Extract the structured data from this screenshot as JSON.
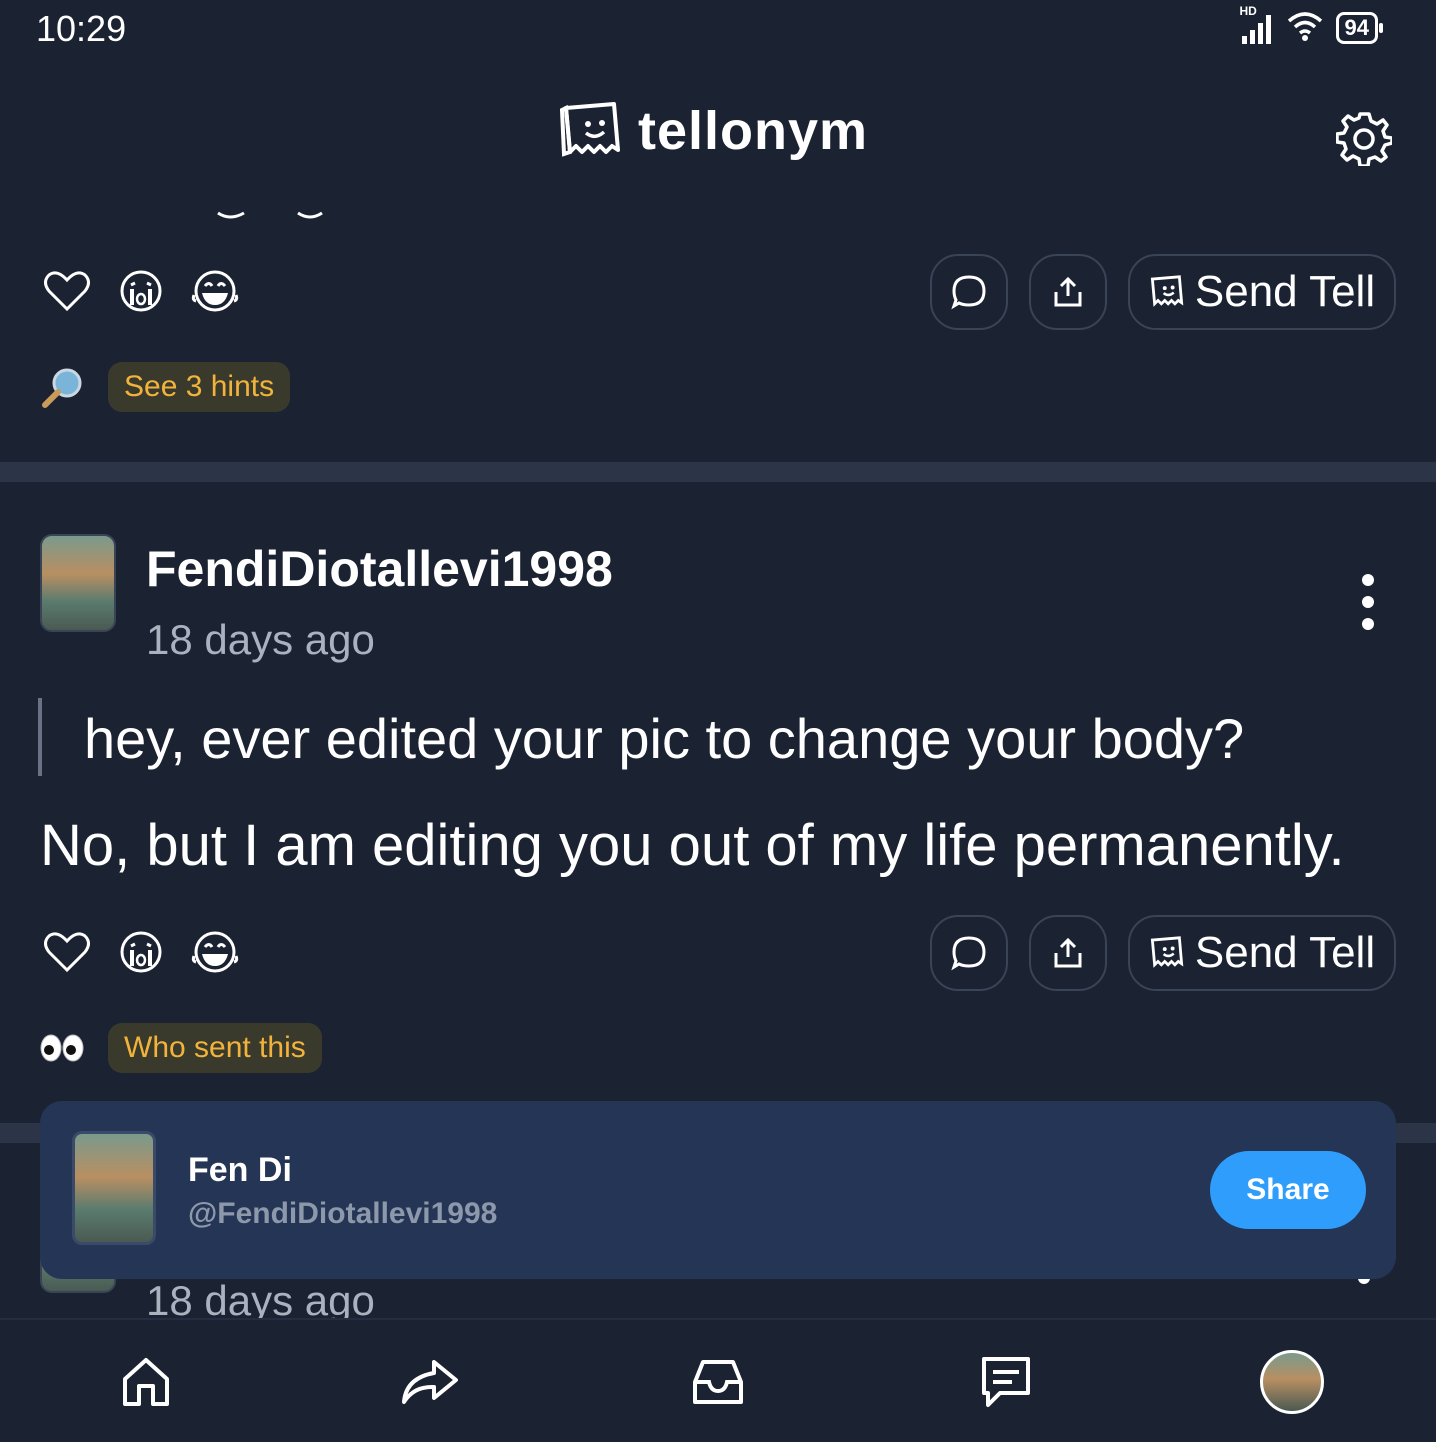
{
  "status_bar": {
    "time": "10:29",
    "network_badge": "HD",
    "battery": "94",
    "icons": [
      "signal-icon",
      "wifi-icon",
      "battery-icon"
    ]
  },
  "header": {
    "app_name": "tellonym",
    "settings_icon": "gear-icon"
  },
  "top_card": {
    "hints_label": "See 3 hints",
    "send_tell_label": "Send Tell"
  },
  "post": {
    "username": "FendiDiotallevi1998",
    "timestamp": "18 days ago",
    "question": "hey, ever edited your pic to change your body?",
    "answer": "No, but I am editing you out of my life permanently.",
    "send_tell_label": "Send Tell",
    "who_sent_label": "Who sent this"
  },
  "next_post": {
    "timestamp": "18 days ago"
  },
  "toast": {
    "name": "Fen Di",
    "handle": "@FendiDiotallevi1998",
    "share_label": "Share"
  },
  "bottom_nav": {
    "items": [
      "home-icon",
      "share-arrow-icon",
      "inbox-icon",
      "chat-icon",
      "profile-avatar"
    ]
  },
  "colors": {
    "background": "#1b2232",
    "hint_text": "#f2b33d",
    "share_button": "#2f9dfb",
    "toast_bg": "#253555"
  }
}
